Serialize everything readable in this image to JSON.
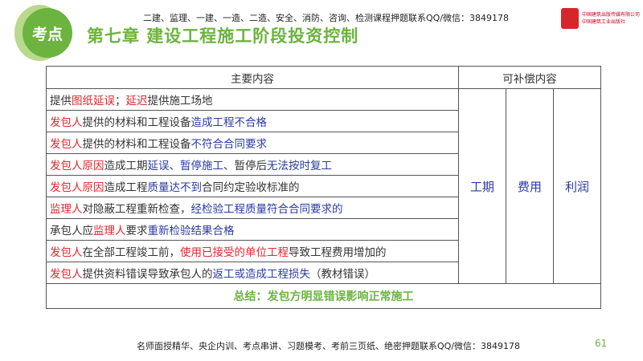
{
  "header": {
    "badge": "考点",
    "ad": "二建、监理、一建、一造、二造、安全、消防、咨询、检测课程押题联系QQ/微信：3849178",
    "title": "第七章  建设工程施工阶段投资控制",
    "logo_text": [
      "中国建筑出版传媒有限公司",
      "中国建筑工业出版社"
    ]
  },
  "table": {
    "headers": [
      "主要内容",
      "可补偿内容"
    ],
    "rows": [
      [
        [
          "k",
          "提供"
        ],
        [
          "r",
          "图纸延误"
        ],
        [
          "k",
          "；"
        ],
        [
          "r",
          "延迟"
        ],
        [
          "k",
          "提供施工场地"
        ]
      ],
      [
        [
          "r",
          "发包人"
        ],
        [
          "k",
          "提供的材料和工程设备"
        ],
        [
          "b",
          "造成工程不合格"
        ]
      ],
      [
        [
          "r",
          "发包人"
        ],
        [
          "k",
          "提供的材料和工程设备"
        ],
        [
          "b",
          "不符合合同要求"
        ]
      ],
      [
        [
          "r",
          "发包人原因"
        ],
        [
          "k",
          "造成工期"
        ],
        [
          "b",
          "延误、暂停施工"
        ],
        [
          "k",
          "、暂停后"
        ],
        [
          "b",
          "无法按时复工"
        ]
      ],
      [
        [
          "r",
          "发包人原因"
        ],
        [
          "k",
          "造成工程"
        ],
        [
          "b",
          "质量达不到"
        ],
        [
          "k",
          "合同约定验收标准的"
        ]
      ],
      [
        [
          "r",
          "监理人"
        ],
        [
          "k",
          "对隐蔽工程重新检查，"
        ],
        [
          "b",
          "经检验工程质量符合合同要求的"
        ]
      ],
      [
        [
          "k",
          "承包人应"
        ],
        [
          "r",
          "监理人"
        ],
        [
          "k",
          "要求"
        ],
        [
          "b",
          "重新检验结果合格"
        ]
      ],
      [
        [
          "r",
          "发包人"
        ],
        [
          "k",
          "在全部工程竣工前，"
        ],
        [
          "r",
          "使用已接受的单位工程"
        ],
        [
          "k",
          "导致工程费用增加的"
        ]
      ],
      [
        [
          "r",
          "发包人"
        ],
        [
          "k",
          "提供资料错误导致承包人的"
        ],
        [
          "b",
          "返工或造成工程损失"
        ],
        [
          "k",
          "（教材错误）"
        ]
      ]
    ],
    "compensation": [
      "工期",
      "费用",
      "利润"
    ],
    "summary": "总结：发包方明显错误影响正常施工"
  },
  "footer": {
    "ad": "名师面授精华、央企内训、考点串讲、习题模考、考前三页纸、绝密押题联系QQ/微信：3849178",
    "page": "61"
  }
}
